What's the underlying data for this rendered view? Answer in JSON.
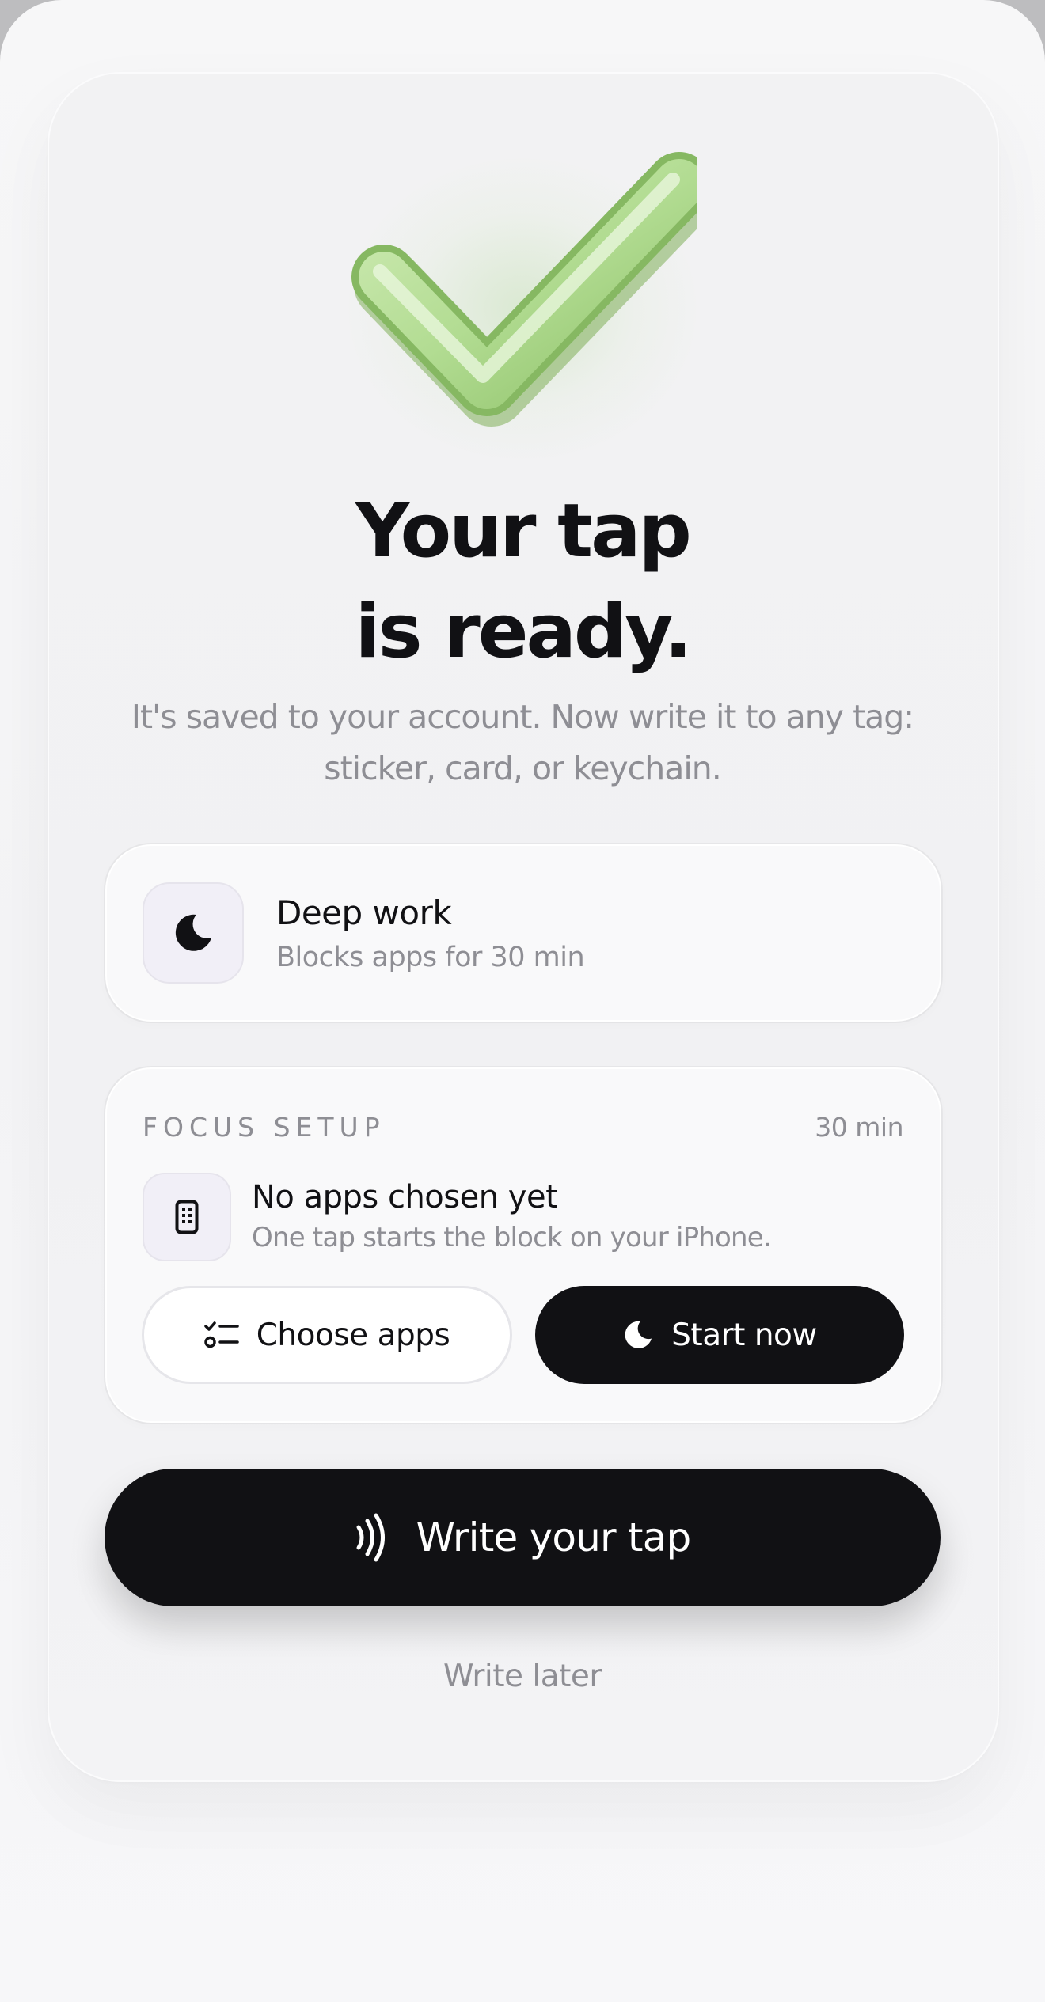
{
  "hero": {
    "title_line1": "Your tap",
    "title_line2": "is ready.",
    "subtitle_line1": "It's saved to your account. Now write it to any tag:",
    "subtitle_line2": "sticker, card, or keychain."
  },
  "mode_card": {
    "icon": "moon-icon",
    "title": "Deep work",
    "subtitle": "Blocks apps for 30 min"
  },
  "focus_setup": {
    "heading": "FOCUS SETUP",
    "duration": "30 min",
    "status_icon": "phone-icon",
    "status_title": "No apps chosen yet",
    "status_subtitle": "One tap starts the block on your iPhone.",
    "choose_apps_icon": "checklist-icon",
    "choose_apps_label": "Choose apps",
    "start_now_icon": "moon-icon",
    "start_now_label": "Start now"
  },
  "actions": {
    "primary_icon": "nfc-waves-icon",
    "primary_label": "Write your tap",
    "secondary_label": "Write later"
  },
  "colors": {
    "background": "#f4f4f6",
    "ink": "#111114",
    "muted": "#8e8e94",
    "accent_green": "#9fd07e",
    "icon_tile": "#f1eff7"
  }
}
